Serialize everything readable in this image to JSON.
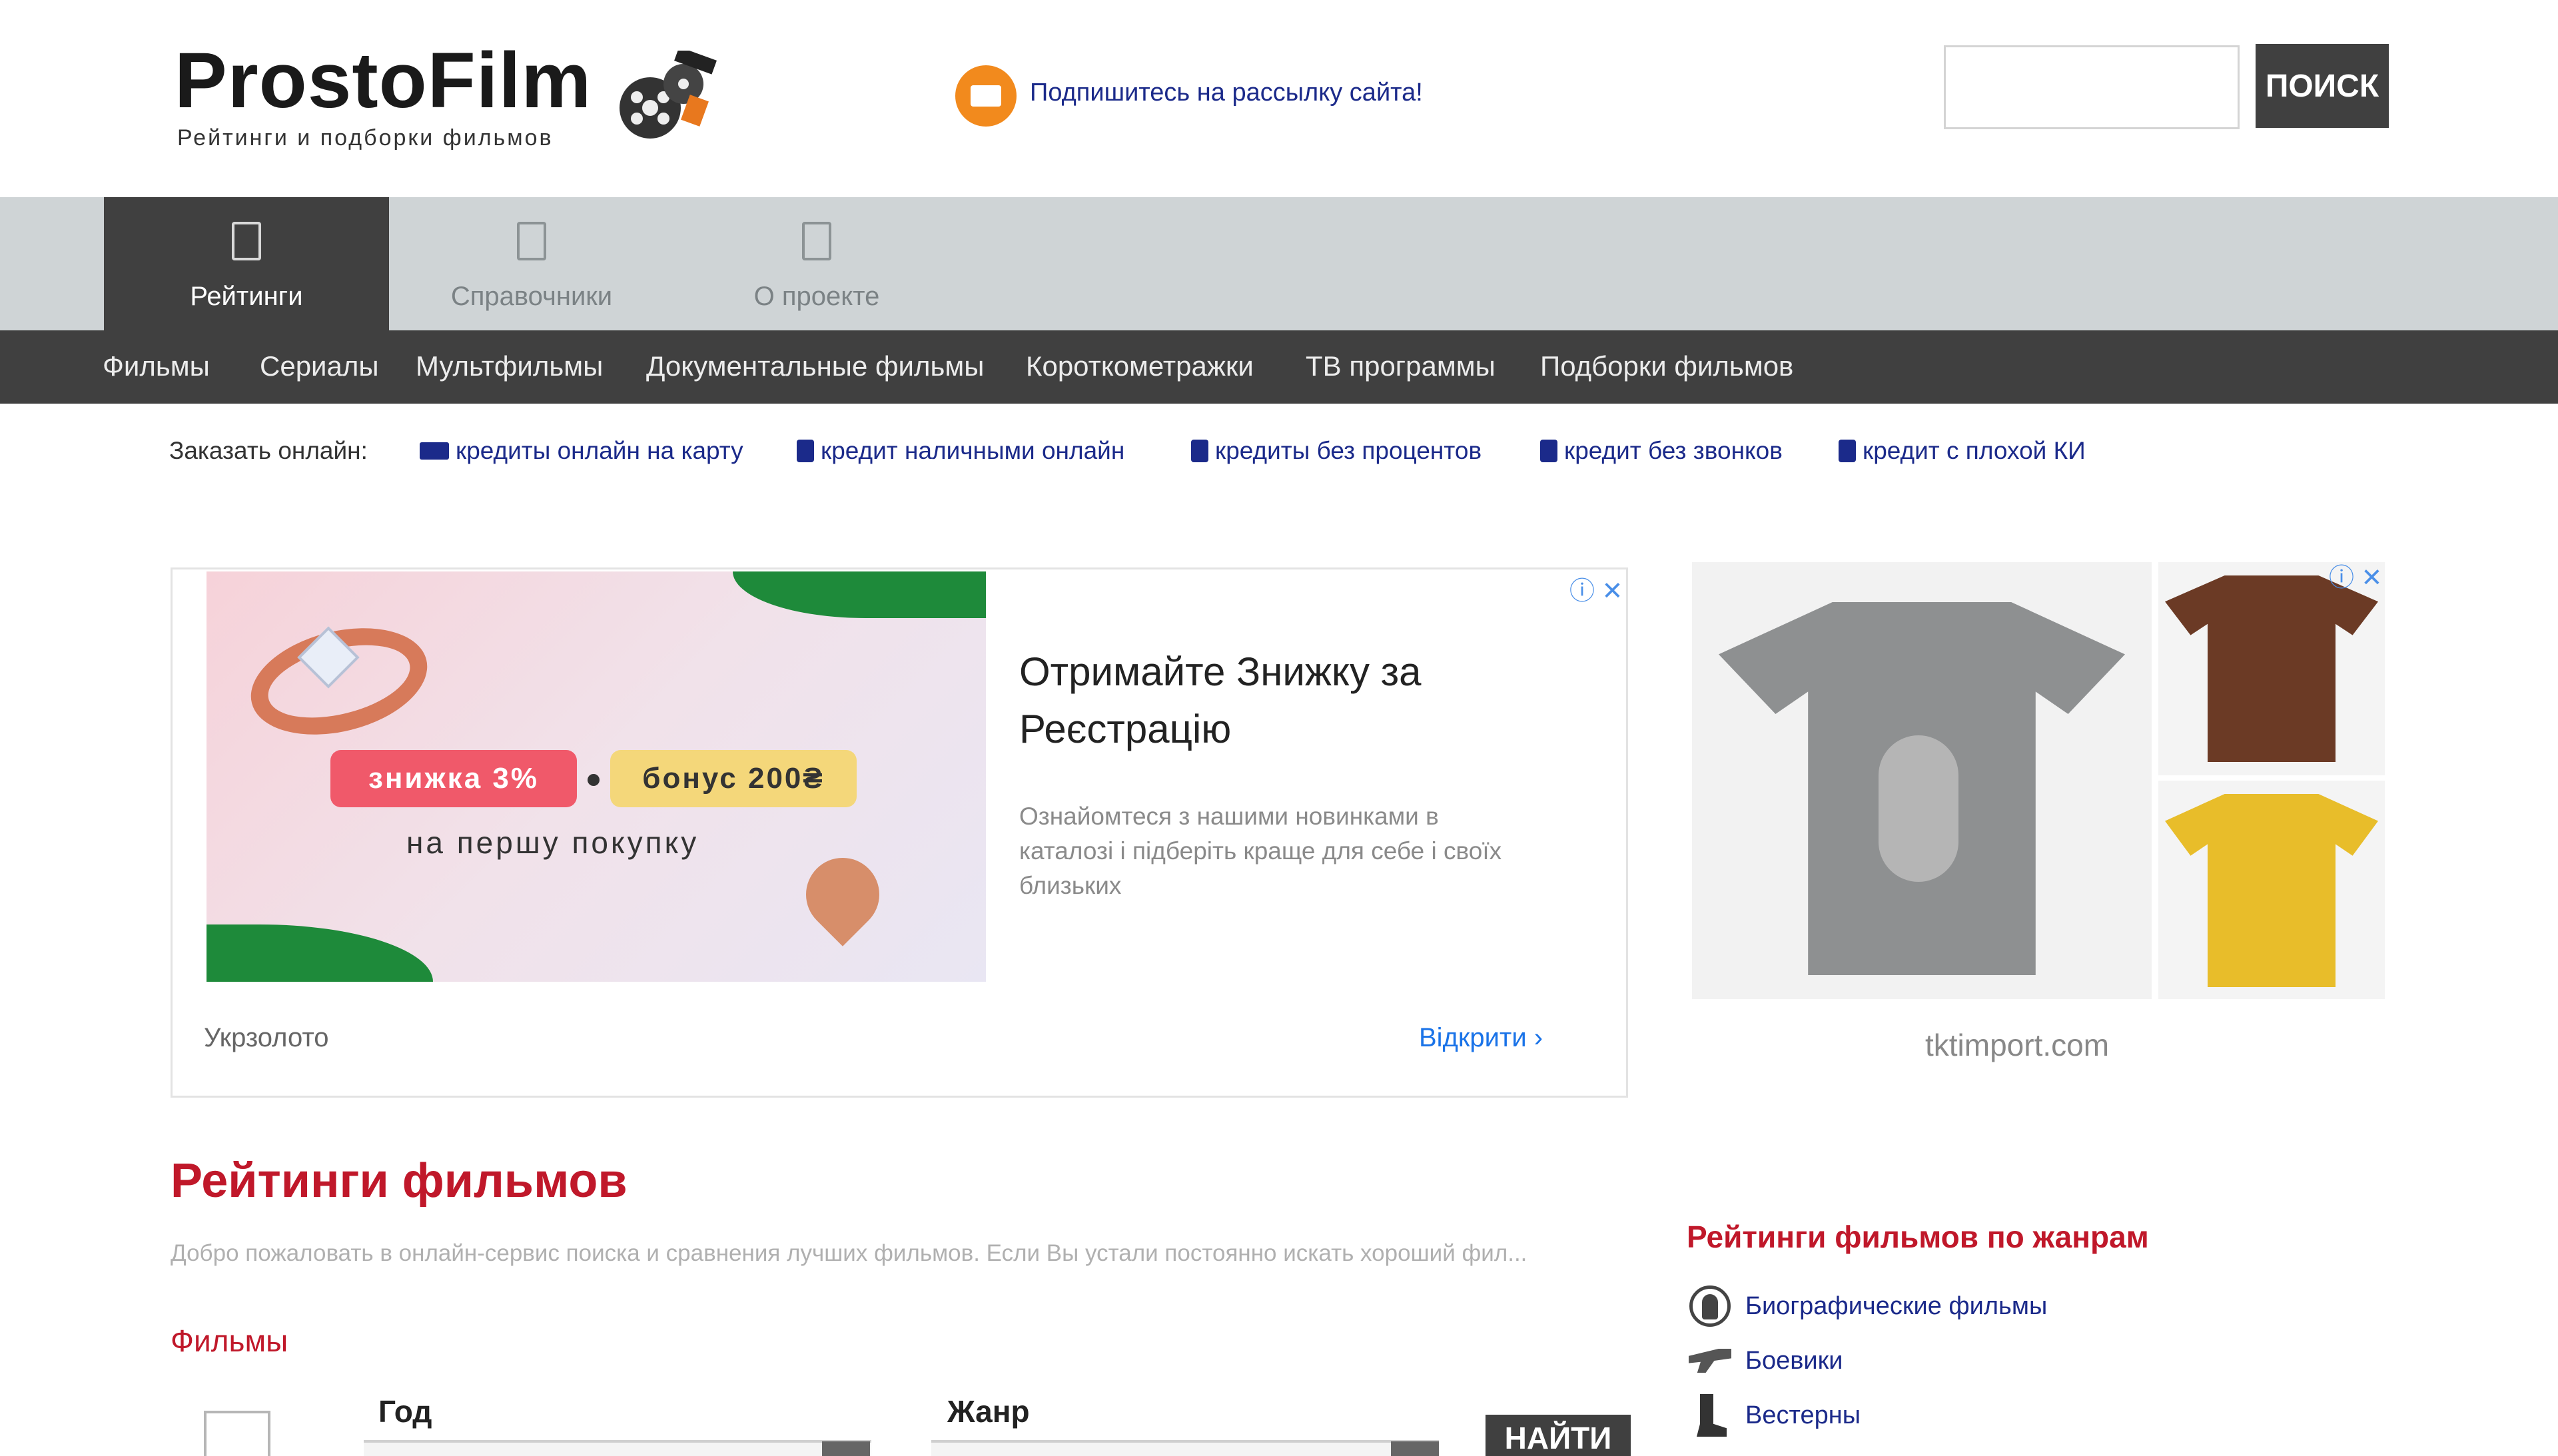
{
  "header": {
    "logo_title": "ProstoFilm",
    "logo_subtitle": "Рейтинги и подборки фильмов",
    "subscribe_text": "Подпишитесь на рассылку сайта!",
    "search_placeholder": "",
    "search_button": "ПОИСК"
  },
  "tabs": [
    {
      "label": "Рейтинги",
      "active": true
    },
    {
      "label": "Справочники",
      "active": false
    },
    {
      "label": "О проекте",
      "active": false
    }
  ],
  "subnav": [
    "Фильмы",
    "Сериалы",
    "Мультфильмы",
    "Документальные фильмы",
    "Короткометражки",
    "ТВ программы",
    "Подборки фильмов"
  ],
  "credit": {
    "label": "Заказать онлайн:",
    "links": [
      "кредиты онлайн на карту",
      "кредит наличными онлайн",
      "кредиты без процентов",
      "кредит без звонков",
      "кредит с плохой КИ"
    ]
  },
  "ad_left": {
    "badge_discount": "знижка 3%",
    "badge_bonus": "бонус 200₴",
    "subline": "на першу покупку",
    "headline": "Отримайте Знижку за Реєстрацію",
    "description": "Ознайомтеся з нашими новинками в каталозі і підберіть краще для себе і своїх близьких",
    "brand": "Укрзолото",
    "open_label": "Відкрити",
    "close_label": "ⓘ ✕"
  },
  "ad_right": {
    "domain": "tktimport.com",
    "close_label": "ⓘ ✕"
  },
  "content": {
    "title": "Рейтинги фильмов",
    "intro": "Добро пожаловать в онлайн-сервис поиска и сравнения лучших фильмов. Если Вы устали постоянно искать хороший фил...",
    "section_title": "Фильмы",
    "filter_year_label": "Год",
    "filter_genre_label": "Жанр",
    "find_button": "НАЙТИ"
  },
  "sidebar": {
    "title": "Рейтинги фильмов по жанрам",
    "genres": [
      {
        "label": "Биографические фильмы",
        "icon": "person-icon"
      },
      {
        "label": "Боевики",
        "icon": "gun-icon"
      },
      {
        "label": "Вестерны",
        "icon": "boot-icon"
      }
    ]
  },
  "colors": {
    "accent_red": "#c0182a",
    "nav_dark": "#404040",
    "link_blue": "#1b2a8a",
    "tab_bar": "#cfd4d6",
    "subscribe_orange": "#f28a1d"
  }
}
